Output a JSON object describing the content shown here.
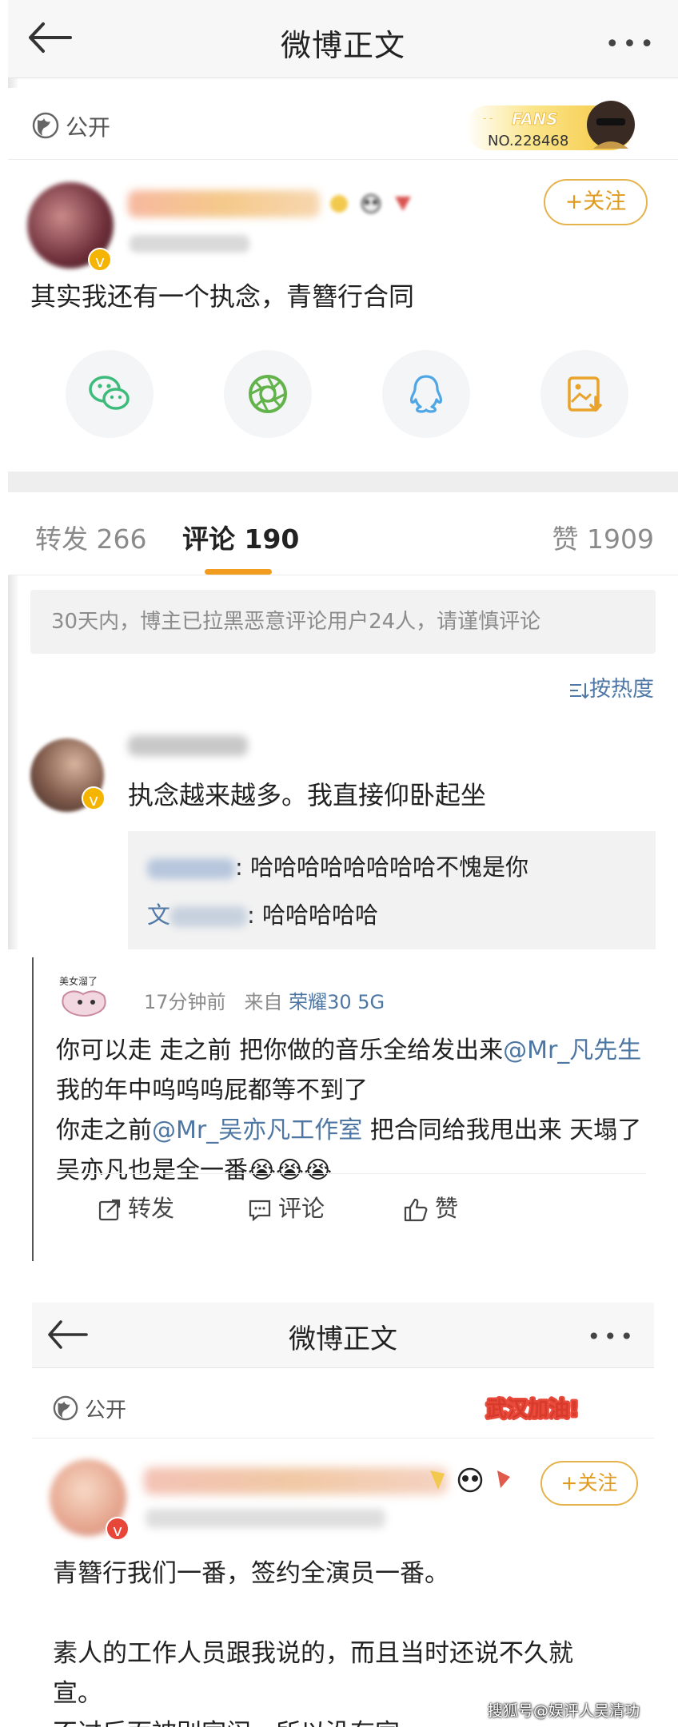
{
  "panel1": {
    "nav": {
      "title": "微博正文",
      "more": "•••"
    },
    "scope": {
      "label": "公开"
    },
    "fans_badge": {
      "text": "FANS",
      "number": "NO.228468"
    },
    "post": {
      "follow_label": "+关注",
      "text": "其实我还有一个执念，青簪行合同",
      "share_icons": [
        "wechat-icon",
        "moments-icon",
        "qq-icon",
        "save-image-icon"
      ]
    },
    "tabs": {
      "repost": "转发 266",
      "comment": "评论 190",
      "like": "赞 1909"
    },
    "notice": "30天内，博主已拉黑恶意评论用户24人，请谨慎评论",
    "sort_label": "按热度",
    "comment": {
      "text": "执念越来越多。我直接仰卧起坐",
      "replies": [
        {
          "prefix": "",
          "text": ": 哈哈哈哈哈哈哈哈不愧是你"
        },
        {
          "prefix": "文",
          "text": ": 哈哈哈哈哈"
        }
      ]
    },
    "colors": {
      "accent": "#f29c1f",
      "link": "#4f78a6",
      "follow": "#e09a1d"
    }
  },
  "panel2": {
    "avatar_text": "美女溜了",
    "time": "17分钟前",
    "source_prefix": "来自",
    "device": "荣耀30 5G",
    "body": {
      "line1": "你可以走 走之前 把你做的音乐全给发出来",
      "mention1": "@Mr_凡先生",
      "line2": " 我的年中呜呜呜屁都等不到了",
      "line3a": "你走之前",
      "mention2": "@Mr_吴亦凡工作室",
      "line3b": " 把合同给我甩出来 天塌了吴亦凡也是全一番",
      "emoji": "😭😭😭"
    },
    "actions": {
      "repost": "转发",
      "comment": "评论",
      "like": "赞"
    }
  },
  "panel3": {
    "nav": {
      "title": "微博正文",
      "more": "•••"
    },
    "scope": {
      "label": "公开"
    },
    "banner": "武汉加油!",
    "follow_label": "+关注",
    "text": [
      "青簪行我们一番，签约全演员一番。",
      "",
      "素人的工作人员跟我说的，而且当时还说不久就",
      "宣。",
      "不过后面被别家闹，所以没有宣"
    ],
    "watermark": "搜狐号@娱评人吴清功"
  }
}
